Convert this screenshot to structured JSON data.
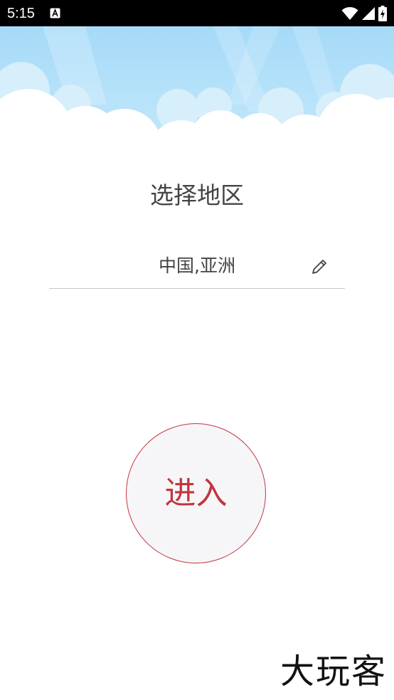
{
  "status_bar": {
    "time": "5:15",
    "icons": [
      "notification-a-icon",
      "wifi-icon",
      "signal-icon",
      "battery-charging-icon"
    ]
  },
  "main": {
    "title": "选择地区",
    "region_value": "中国,亚洲",
    "enter_label": "进入"
  },
  "watermark": {
    "text": "大玩客"
  },
  "colors": {
    "accent": "#c1363f",
    "sky": "#a9dcf7",
    "text": "#444444"
  }
}
